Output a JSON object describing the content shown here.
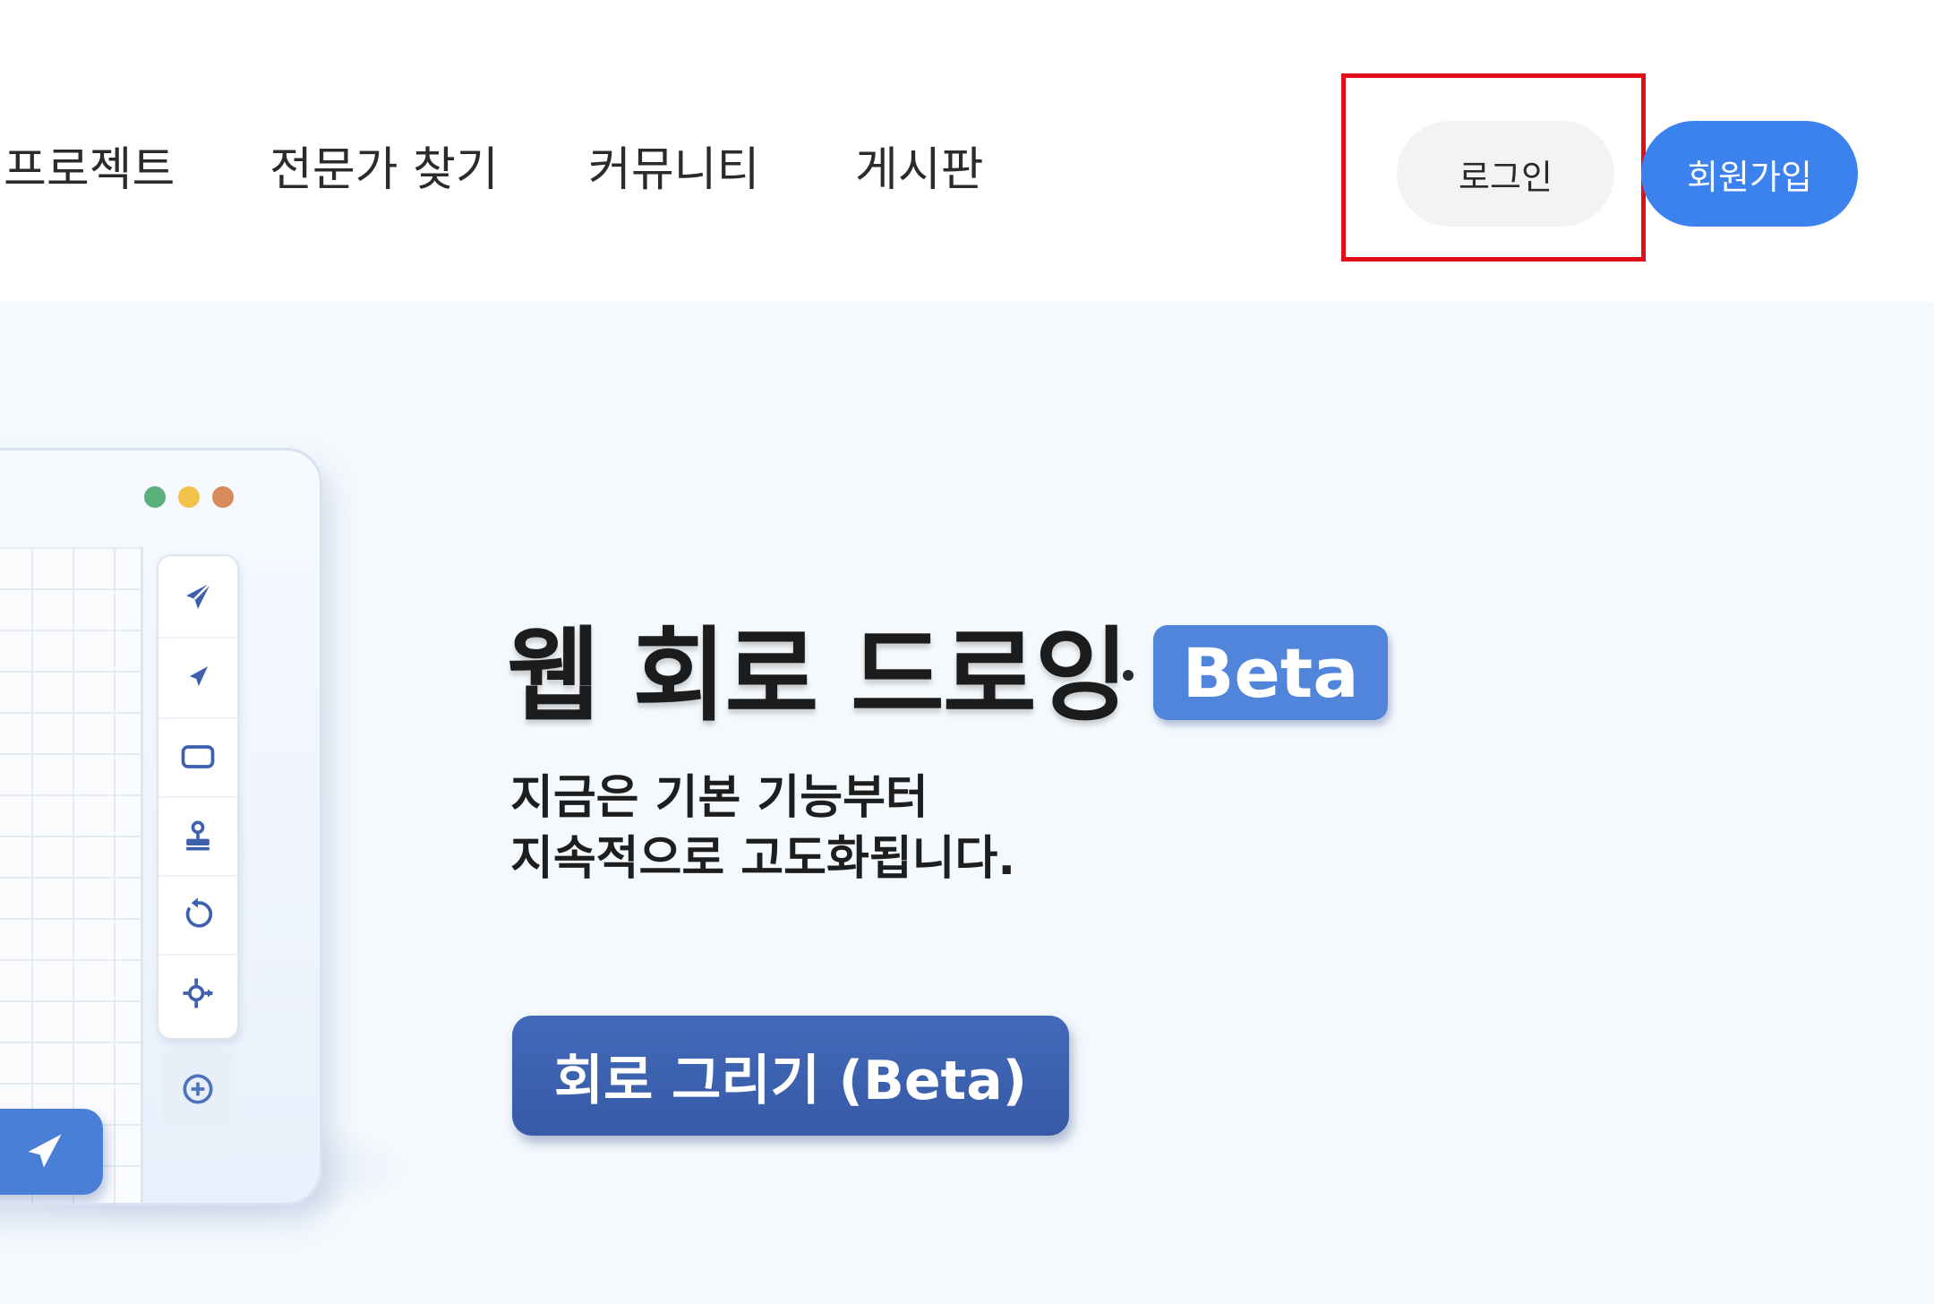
{
  "header": {
    "nav": [
      {
        "label": "프로젝트"
      },
      {
        "label": "전문가 찾기"
      },
      {
        "label": "커뮤니티"
      },
      {
        "label": "게시판"
      }
    ],
    "login_label": "로그인",
    "signup_label": "회원가입"
  },
  "hero": {
    "title": "웹 회로 드로잉",
    "badge": "Beta",
    "subtitle_line1": "지금은 기본 기능부터",
    "subtitle_line2": "지속적으로 고도화됩니다.",
    "cta_label": "회로 그리기 (Beta)"
  },
  "illustration": {
    "tools": [
      "send-icon",
      "small-send-icon",
      "rectangle-icon",
      "stamp-icon",
      "rotate-icon",
      "move-icon"
    ],
    "extra_tool": "target-icon",
    "pill_icons": [
      "speech-bubble-icon",
      "send-icon"
    ]
  },
  "colors": {
    "signup": "#3b82ef",
    "login_bg": "#f3f3f3",
    "highlight": "#e10e17",
    "hero_bg": "#f4f9fd",
    "badge": "#5185dc",
    "cta": "#3d62b0"
  }
}
